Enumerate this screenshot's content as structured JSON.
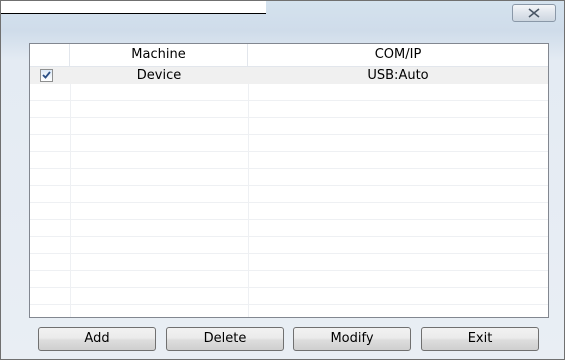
{
  "window": {
    "close_icon": "close-icon"
  },
  "table": {
    "columns": [
      "",
      "Machine",
      "COM/IP"
    ],
    "rows": [
      {
        "checked": true,
        "machine": "Device",
        "com_ip": "USB:Auto"
      }
    ]
  },
  "buttons": {
    "add": "Add",
    "delete": "Delete",
    "modify": "Modify",
    "exit": "Exit"
  },
  "colors": {
    "selected_row": "#f0f0f0",
    "check_mark": "#2a4f86"
  }
}
